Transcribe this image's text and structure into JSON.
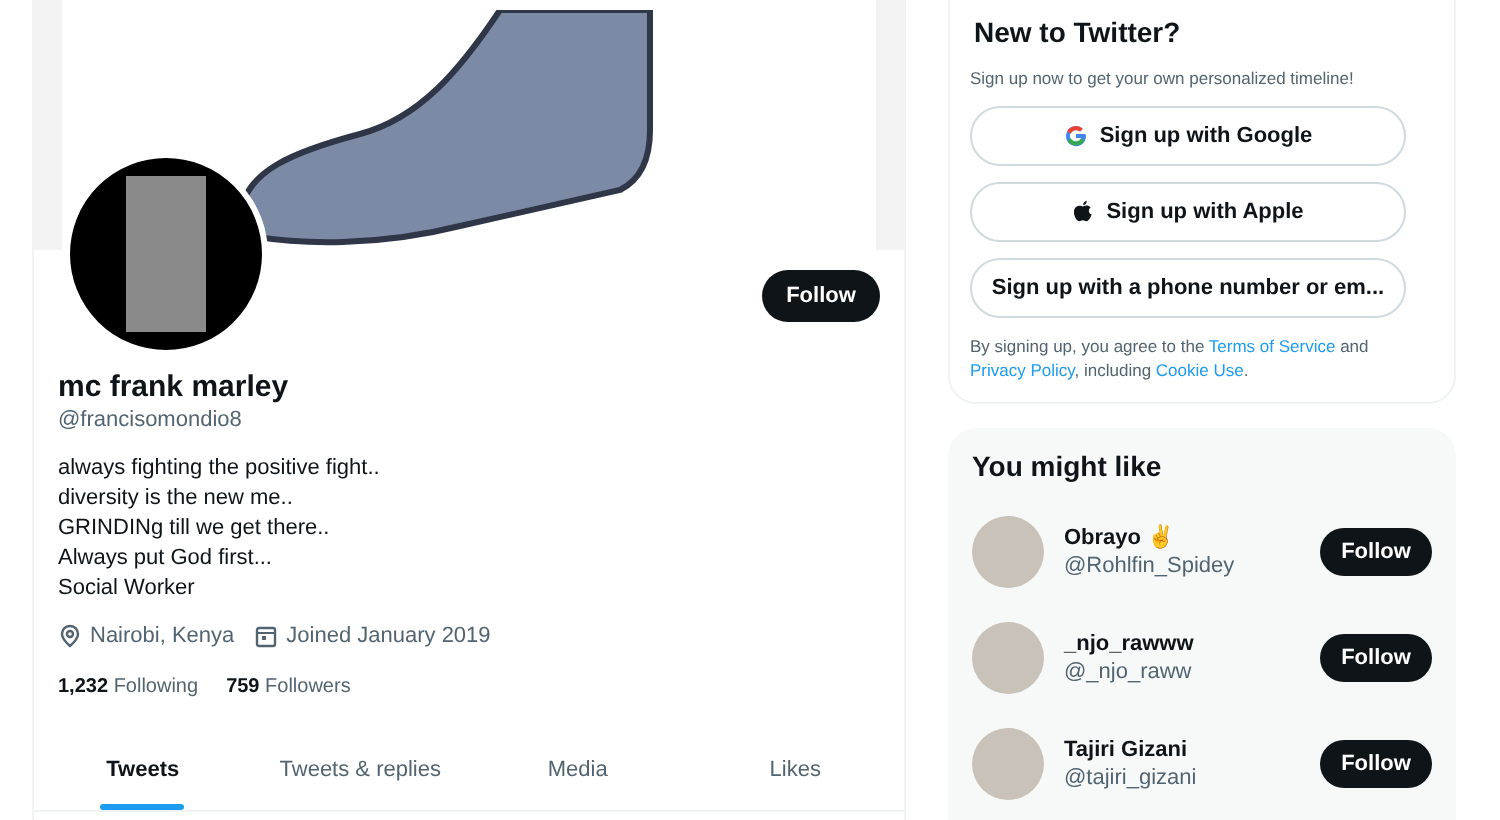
{
  "profile": {
    "follow_button": "Follow",
    "name": "mc frank marley",
    "handle": "@francisomondio8",
    "bio": [
      "always fighting the positive fight..",
      "diversity is the new me..",
      "GRINDINg till we get there..",
      "Always put God first...",
      "Social Worker"
    ],
    "location": "Nairobi, Kenya",
    "joined": "Joined January 2019",
    "stats": [
      {
        "count": "1,232",
        "label": "Following"
      },
      {
        "count": "759",
        "label": "Followers"
      }
    ]
  },
  "tabs": [
    {
      "label": "Tweets",
      "selected": true
    },
    {
      "label": "Tweets & replies",
      "selected": false
    },
    {
      "label": "Media",
      "selected": false
    },
    {
      "label": "Likes",
      "selected": false
    }
  ],
  "signup": {
    "title": "New to Twitter?",
    "subtitle": "Sign up now to get your own personalized timeline!",
    "buttons": [
      {
        "label": "Sign up with Google",
        "kind": "google"
      },
      {
        "label": "Sign up with Apple",
        "kind": "apple"
      },
      {
        "label": "Sign up with a phone number or em...",
        "kind": "plain"
      }
    ],
    "legal": [
      {
        "kind": "text",
        "text": "By signing up, you agree to the "
      },
      {
        "kind": "link",
        "text": "Terms of Service"
      },
      {
        "kind": "text",
        "text": " and "
      },
      {
        "kind": "link",
        "text": "Privacy Policy"
      },
      {
        "kind": "text",
        "text": ", including "
      },
      {
        "kind": "link",
        "text": "Cookie Use"
      },
      {
        "kind": "text",
        "text": "."
      }
    ]
  },
  "suggestions": {
    "title": "You might like",
    "users": [
      {
        "name": "Obrayo ✌",
        "handle": "@Rohlfin_Spidey",
        "button": "Follow"
      },
      {
        "name": "_njo_rawww",
        "handle": "@_njo_raww",
        "button": "Follow"
      },
      {
        "name": "Tajiri Gizani",
        "handle": "@tajiri_gizani",
        "button": "Follow"
      }
    ]
  }
}
